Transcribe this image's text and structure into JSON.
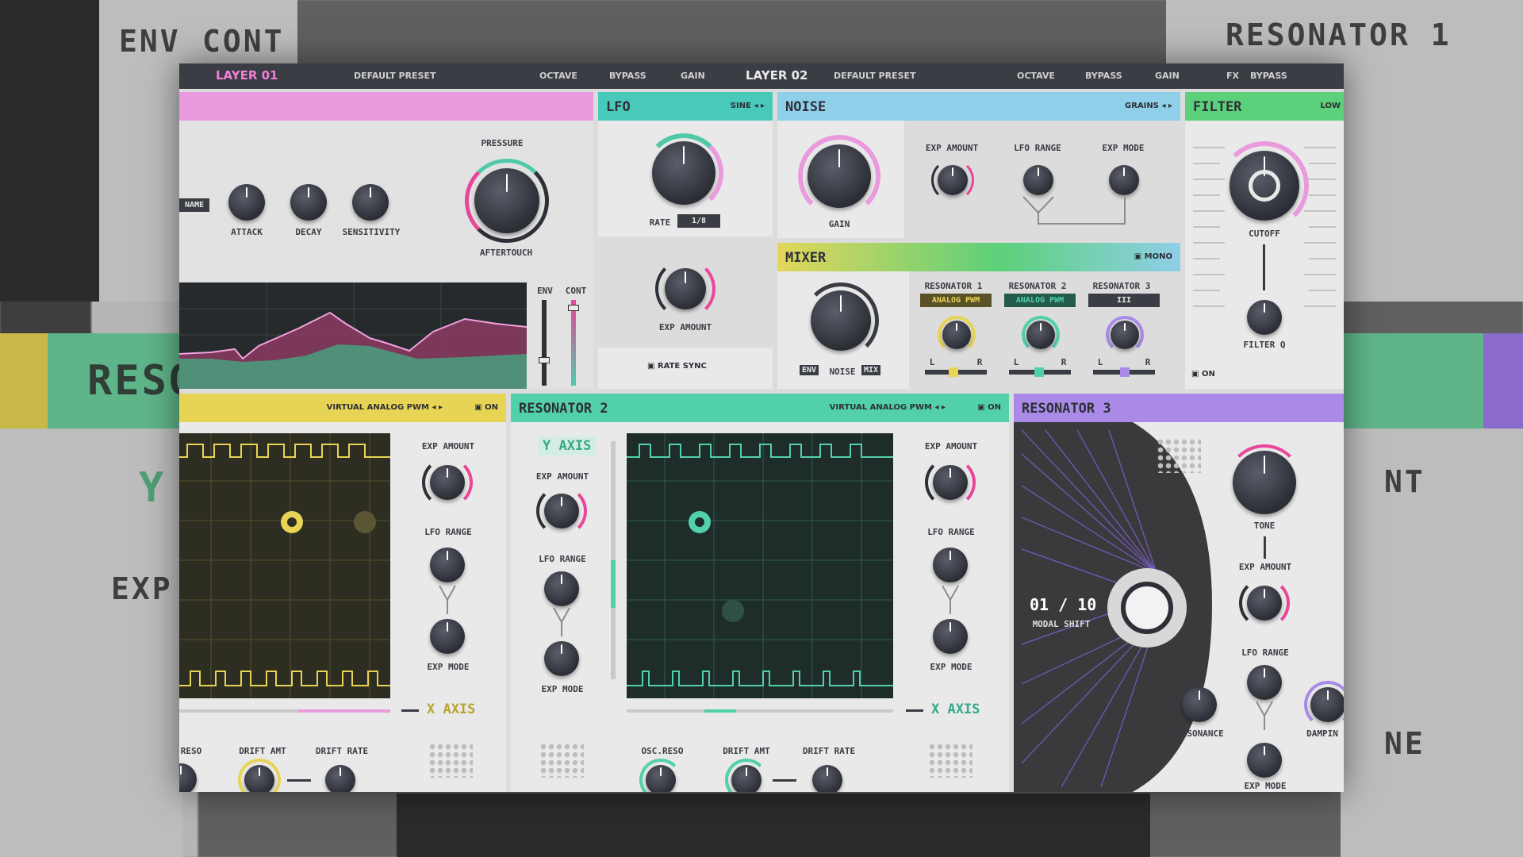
{
  "background": {
    "labels": [
      "ENV",
      "CONT",
      "RESONATOR 1",
      "RESO",
      "EXP A",
      "Y A",
      "NT",
      "NE"
    ]
  },
  "topbar": {
    "layer1": "LAYER 01",
    "preset1": "DEFAULT PRESET",
    "octave1": "OCTAVE",
    "bypass1": "BYPASS",
    "gain1": "GAIN",
    "layer2": "LAYER 02",
    "preset2": "DEFAULT PRESET",
    "octave2": "OCTAVE",
    "bypass2": "BYPASS",
    "gain2": "GAIN",
    "fx": "FX",
    "fx_bypass": "BYPASS"
  },
  "exciter": {
    "mode_label": "NAME",
    "attack": "ATTACK",
    "decay": "DECAY",
    "sensitivity": "SENSITIVITY",
    "pressure": "PRESSURE",
    "aftertouch": "AFTERTOUCH",
    "env": "ENV",
    "cont": "CONT",
    "accent": "#e99bdd"
  },
  "lfo": {
    "title": "LFO",
    "shape": "SINE",
    "rate": "RATE",
    "rate_value": "1/8",
    "exp_amount": "EXP AMOUNT",
    "rate_sync": "RATE SYNC",
    "accent": "#49c9b9"
  },
  "noise": {
    "title": "NOISE",
    "type": "GRAINS",
    "gain": "GAIN",
    "exp_amount": "EXP AMOUNT",
    "lfo_range": "LFO RANGE",
    "exp_mode": "EXP MODE",
    "accent": "#8fcfe9"
  },
  "filter": {
    "title": "FILTER",
    "type": "LOW",
    "cutoff": "CUTOFF",
    "filter_q": "FILTER Q",
    "on": "ON",
    "accent": "#5cd07a"
  },
  "mixer": {
    "title": "MIXER",
    "mono": "MONO",
    "noise": "NOISE",
    "env": "ENV",
    "mix": "MIX",
    "res1": "RESONATOR 1",
    "res1_mode": "ANALOG PWM",
    "res2": "RESONATOR 2",
    "res2_mode": "ANALOG PWM",
    "res3": "RESONATOR 3",
    "res3_mode": "III",
    "l": "L",
    "r": "R"
  },
  "res1": {
    "mode": "VIRTUAL ANALOG PWM",
    "on": "ON",
    "exp_amount": "EXP AMOUNT",
    "lfo_range": "LFO RANGE",
    "exp_mode": "EXP MODE",
    "x_axis": "X AXIS",
    "reso": "RESO",
    "drift_amt": "DRIFT AMT",
    "drift_rate": "DRIFT RATE",
    "accent": "#e8d454"
  },
  "res2": {
    "title": "RESONATOR 2",
    "mode": "VIRTUAL ANALOG PWM",
    "on": "ON",
    "y_axis": "Y AXIS",
    "exp_amount_l": "EXP AMOUNT",
    "lfo_range_l": "LFO RANGE",
    "exp_mode_l": "EXP MODE",
    "exp_amount_r": "EXP AMOUNT",
    "lfo_range_r": "LFO RANGE",
    "exp_mode_r": "EXP MODE",
    "x_axis": "X AXIS",
    "osc_reso": "OSC.RESO",
    "drift_amt": "DRIFT AMT",
    "drift_rate": "DRIFT RATE",
    "accent": "#52d0aa"
  },
  "res3": {
    "title": "RESONATOR 3",
    "counter": "01 / 10",
    "modal_shift": "MODAL SHIFT",
    "tone": "TONE",
    "exp_amount": "EXP AMOUNT",
    "lfo_range": "LFO RANGE",
    "exp_mode": "EXP MODE",
    "resonance": "RESONANCE",
    "damping": "DAMPIN",
    "accent": "#a98ae6"
  }
}
